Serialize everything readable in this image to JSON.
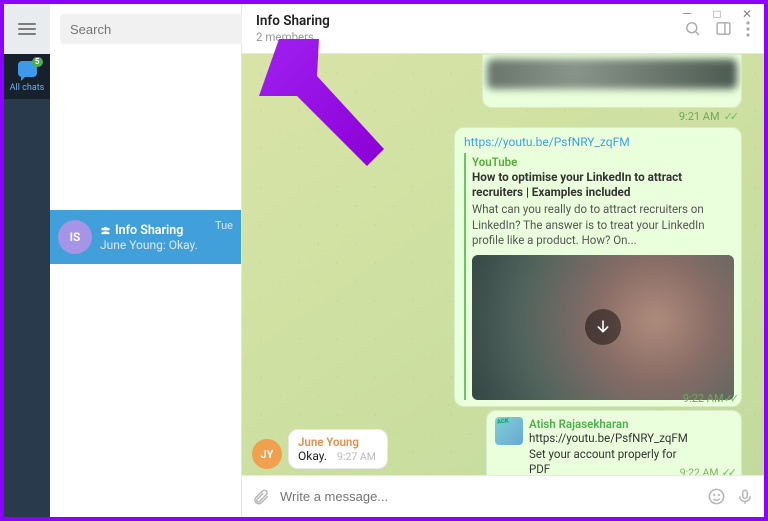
{
  "window": {
    "min": "—",
    "max": "□",
    "close": "✕"
  },
  "rail": {
    "tab_label": "All chats",
    "badge": "5"
  },
  "search": {
    "placeholder": "Search"
  },
  "chatlist": {
    "items": [
      {
        "initials": "IS",
        "name": "Info Sharing",
        "preview": "June Young: Okay.",
        "date": "Tue"
      }
    ]
  },
  "header": {
    "title": "Info Sharing",
    "subtitle": "2 members"
  },
  "messages": {
    "time_921": "9:21 AM",
    "link_url": "https://youtu.be/PsfNRY_zqFM",
    "preview": {
      "site": "YouTube",
      "title": "How to optimise your LinkedIn to attract recruiters | Examples included",
      "desc": "What can you really do to attract recruiters on LinkedIn? The answer is to treat your LinkedIn profile like a product. How? On..."
    },
    "time_922": "9:22 AM",
    "forward": {
      "name": "Atish Rajasekharan",
      "line1": "https://youtu.be/PsfNRY_zqFM",
      "line2": "Set your account properly for PDF",
      "time": "9:22 AM"
    },
    "incoming": {
      "initials": "JY",
      "name": "June Young",
      "text": "Okay.",
      "time": "9:27 AM"
    }
  },
  "compose": {
    "placeholder": "Write a message..."
  }
}
